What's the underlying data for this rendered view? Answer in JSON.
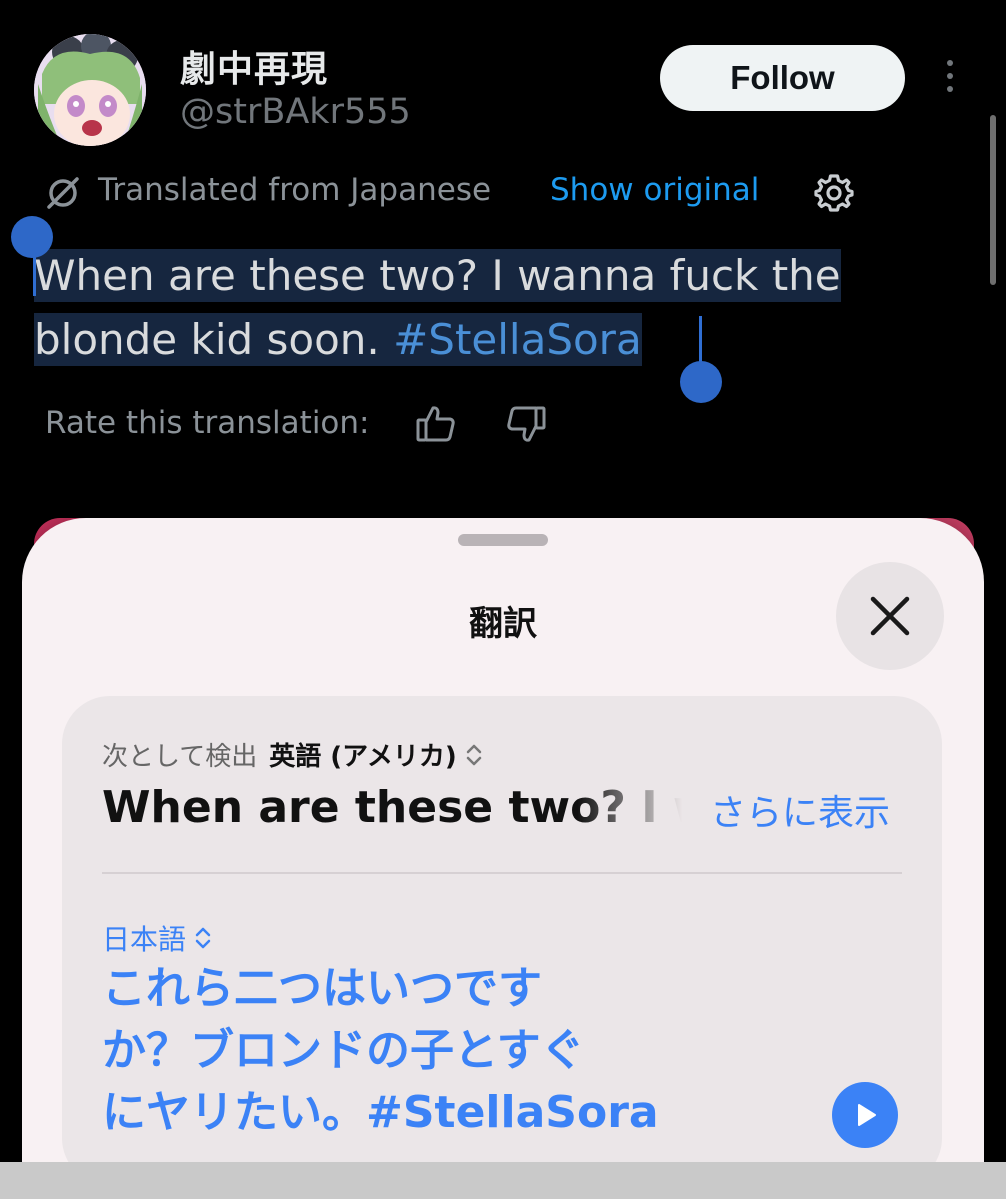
{
  "tweet": {
    "display_name": "劇中再現",
    "handle": "@strBAkr555",
    "follow_label": "Follow",
    "translated_from": "Translated from Japanese",
    "show_original": "Show original",
    "text_line1": "When are these two? I wanna fuck the",
    "text_line2_plain": "blonde kid soon. ",
    "text_line2_hashtag": "#StellaSora",
    "rate_label": "Rate this translation:"
  },
  "sheet": {
    "title": "翻訳",
    "detected_prefix": "次として検出",
    "detected_language": "英語 (アメリカ)",
    "source_text": "When are these two? I wanna",
    "show_more": "さらに表示",
    "target_language": "日本語",
    "target_line1": "これら二つはいつです",
    "target_line2": "か？ブロンドの子とすぐ",
    "target_line3": "にヤリたい。#StellaSora"
  },
  "icons": {
    "translate": "translate-icon",
    "settings": "gear-icon",
    "thumb_up": "thumb-up-icon",
    "thumb_down": "thumb-down-icon",
    "close": "close-icon",
    "play": "play-icon",
    "more": "more-vertical-icon",
    "language_switch": "chevron-updown-icon"
  },
  "colors": {
    "accent_blue": "#1d9bf0",
    "ios_blue": "#3b82f6",
    "selection": "#16263f",
    "selection_handle": "#2e68c8"
  }
}
